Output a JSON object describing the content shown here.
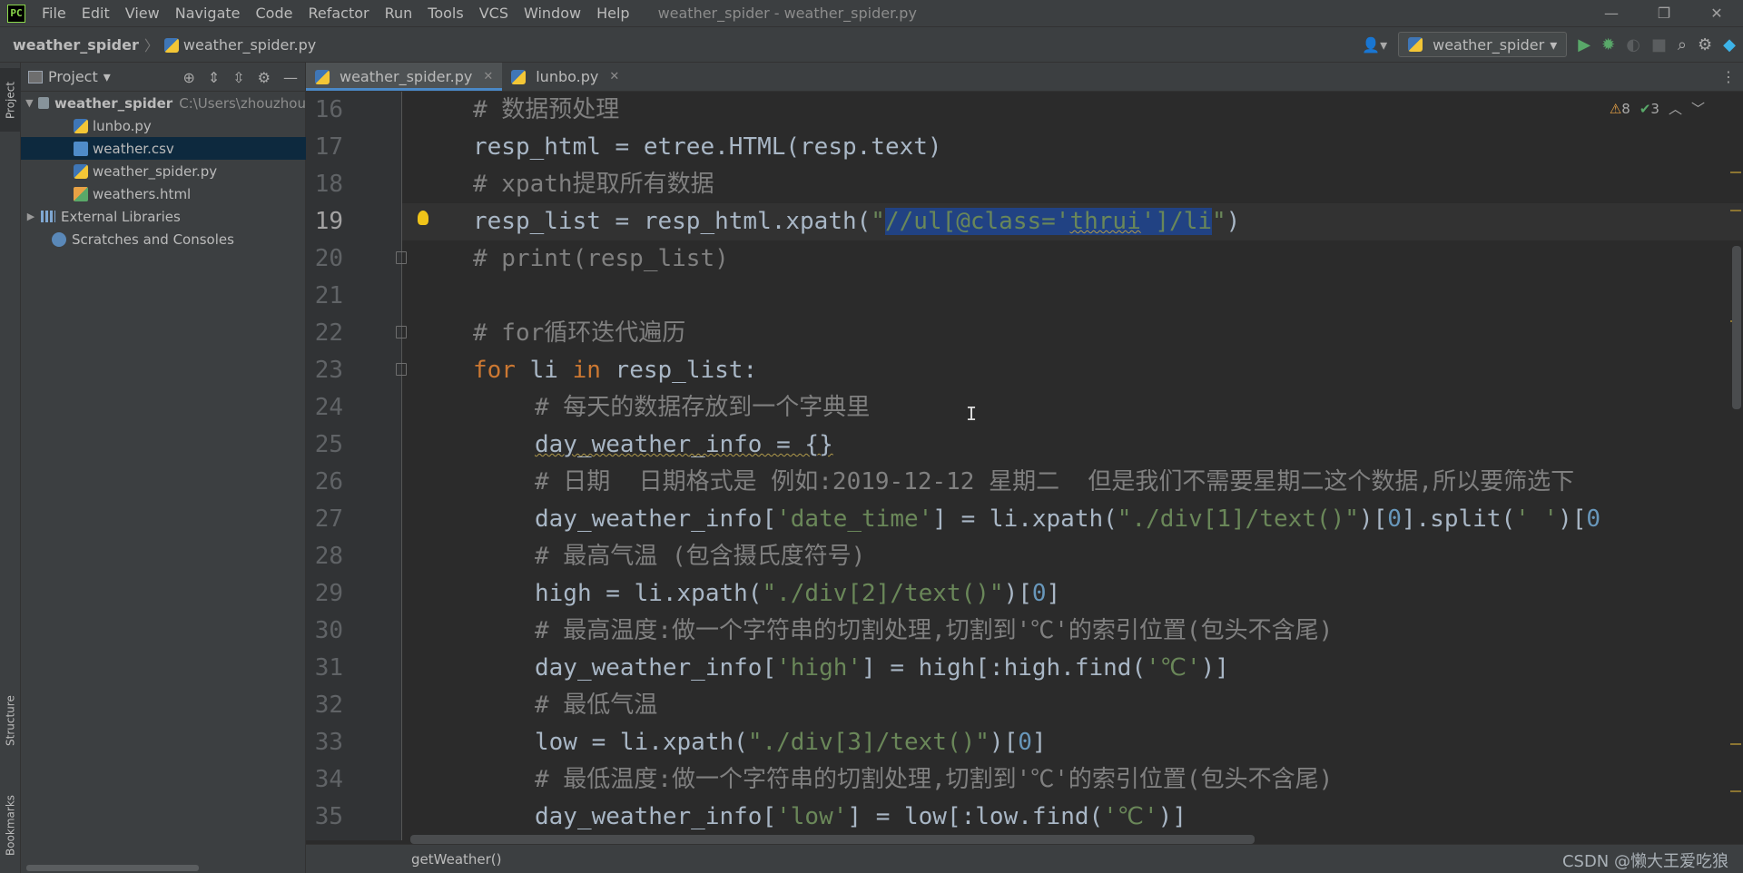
{
  "title_bar": {
    "app_icon_label": "PC",
    "menu": [
      "File",
      "Edit",
      "View",
      "Navigate",
      "Code",
      "Refactor",
      "Run",
      "Tools",
      "VCS",
      "Window",
      "Help"
    ],
    "window_title": "weather_spider - weather_spider.py",
    "controls": {
      "minimize": "—",
      "restore": "❐",
      "close": "✕"
    }
  },
  "nav_bar": {
    "project": "weather_spider",
    "separator": "〉",
    "file": "weather_spider.py",
    "run_config": "weather_spider",
    "icons": [
      "user-icon",
      "run-icon",
      "debug-icon",
      "coverage-icon",
      "stop-icon",
      "search-icon",
      "settings-icon",
      "jetbrains-icon"
    ]
  },
  "left_strip": {
    "project_tab": "Project",
    "structure_tab": "Structure",
    "bookmarks_tab": "Bookmarks"
  },
  "project_panel": {
    "title": "Project",
    "root": {
      "name": "weather_spider",
      "path": "C:\\Users\\zhouzhou"
    },
    "files": [
      "lunbo.py",
      "weather.csv",
      "weather_spider.py",
      "weathers.html"
    ],
    "selected_file": "weather.csv",
    "external_libraries": "External Libraries",
    "scratches": "Scratches and Consoles"
  },
  "tabs": [
    {
      "label": "weather_spider.py",
      "active": true
    },
    {
      "label": "lunbo.py",
      "active": false
    }
  ],
  "editor": {
    "inspection": {
      "warnings": "8",
      "weak_warnings": "3"
    },
    "current_line": 19,
    "lines": [
      16,
      17,
      18,
      19,
      20,
      21,
      22,
      23,
      24,
      25,
      26,
      27,
      28,
      29,
      30,
      31,
      32,
      33,
      34,
      35
    ],
    "code": {
      "l16": "# 数据预处理",
      "l17": "resp_html = etree.HTML(resp.text)",
      "l18": "# xpath提取所有数据",
      "l19a": "resp_list = resp_html.xpath(",
      "l19b": "\"",
      "l19c": "//ul[@class='",
      "l19d": "thrui",
      "l19e": "']/li",
      "l19f": "\"",
      "l19g": ")",
      "l20": "# print(resp_list)",
      "l22": "# for循环迭代遍历",
      "l23_kw1": "for",
      "l23_mid": " li ",
      "l23_kw2": "in",
      "l23_end": " resp_list:",
      "l24": "# 每天的数据存放到一个字典里",
      "l25": "day_weather_info = {}",
      "l26": "# 日期  日期格式是 例如:2019-12-12 星期二  但是我们不需要星期二这个数据,所以要筛选下",
      "l27a": "day_weather_info[",
      "l27b": "'date_time'",
      "l27c": "] = li.xpath(",
      "l27d": "\"./div[1]/text()\"",
      "l27e": ")[",
      "l27f": "0",
      "l27g": "].split(",
      "l27h": "' '",
      "l27i": ")[",
      "l27j": "0",
      "l28": "# 最高气温 (包含摄氏度符号)",
      "l29a": "high = li.xpath(",
      "l29b": "\"./div[2]/text()\"",
      "l29c": ")[",
      "l29d": "0",
      "l29e": "]",
      "l30": "# 最高温度:做一个字符串的切割处理,切割到'℃'的索引位置(包头不含尾)",
      "l31a": "day_weather_info[",
      "l31b": "'high'",
      "l31c": "] = high[:high.find(",
      "l31d": "'℃'",
      "l31e": ")]",
      "l32": "# 最低气温",
      "l33a": "low = li.xpath(",
      "l33b": "\"./div[3]/text()\"",
      "l33c": ")[",
      "l33d": "0",
      "l33e": "]",
      "l34": "# 最低温度:做一个字符串的切割处理,切割到'℃'的索引位置(包头不含尾)",
      "l35a": "day_weather_info[",
      "l35b": "'low'",
      "l35c": "] = low[:low.find(",
      "l35d": "'℃'",
      "l35e": ")]"
    }
  },
  "status_bar": {
    "breadcrumb": "getWeather()",
    "watermark": "CSDN @懒大王爱吃狼"
  },
  "colors": {
    "keyword": "#cc7832",
    "string": "#6a8759",
    "number": "#6897bb",
    "comment": "#808080",
    "selection": "#214283",
    "background": "#2b2b2b"
  }
}
